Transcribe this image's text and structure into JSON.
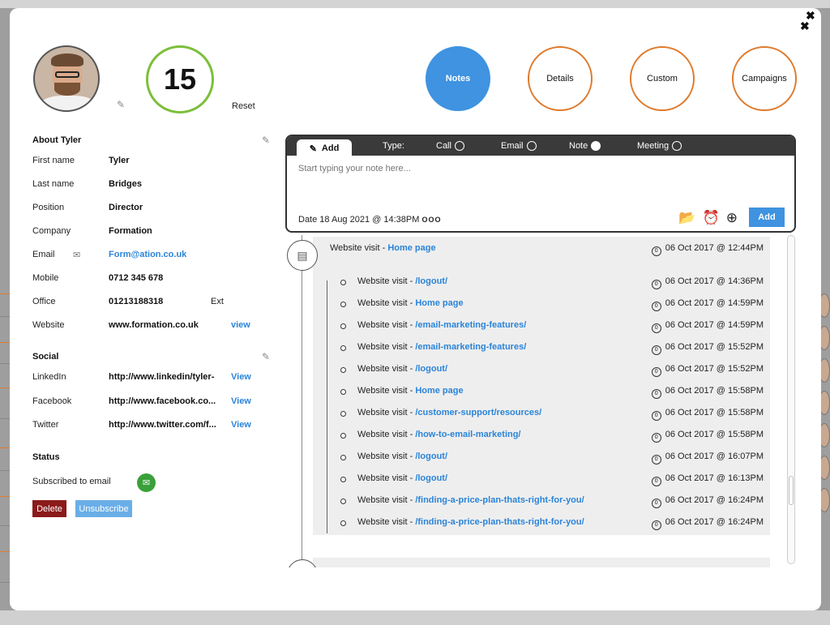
{
  "close_label": "✖",
  "contact": {
    "score": "15",
    "reset_label": "Reset"
  },
  "tabs": [
    {
      "label": "Notes",
      "active": true
    },
    {
      "label": "Details",
      "active": false
    },
    {
      "label": "Custom",
      "active": false
    },
    {
      "label": "Campaigns",
      "active": false
    }
  ],
  "about": {
    "title": "About Tyler",
    "fields": [
      {
        "label": "First name",
        "value": "Tyler"
      },
      {
        "label": "Last name",
        "value": "Bridges"
      },
      {
        "label": "Position",
        "value": "Director"
      },
      {
        "label": "Company",
        "value": "Formation"
      },
      {
        "label": "Email",
        "value": "Form@ation.co.uk"
      },
      {
        "label": "Mobile",
        "value": "0712 345 678"
      },
      {
        "label": "Office",
        "value": "01213188318",
        "ext_label": "Ext"
      },
      {
        "label": "Website",
        "value": "www.formation.co.uk",
        "action": "view"
      }
    ]
  },
  "social": {
    "title": "Social",
    "fields": [
      {
        "label": "LinkedIn",
        "value": "http://www.linkedin/tyler-",
        "action": "View"
      },
      {
        "label": "Facebook",
        "value": "http://www.facebook.co...",
        "action": "View"
      },
      {
        "label": "Twitter",
        "value": "http://www.twitter.com/f...",
        "action": "View"
      }
    ]
  },
  "status": {
    "title": "Status",
    "subscribed_label": "Subscribed to email",
    "delete_label": "Delete",
    "unsubscribe_label": "Unsubscribe"
  },
  "note": {
    "add_tab": "Add",
    "type_label": "Type:",
    "types": [
      {
        "label": "Call",
        "selected": false
      },
      {
        "label": "Email",
        "selected": false
      },
      {
        "label": "Note",
        "selected": true
      },
      {
        "label": "Meeting",
        "selected": false
      }
    ],
    "placeholder": "Start typing your note here...",
    "date_text": "Date 18 Aug 2021 @ 14:38PM",
    "more_label": "OOO",
    "add_button": "Add"
  },
  "timeline": {
    "main": {
      "prefix": "Website visit - ",
      "page": "Home page",
      "when": "06 Oct 2017 @ 12:44PM"
    },
    "items": [
      {
        "prefix": "Website visit - ",
        "page": "/logout/",
        "when": "06 Oct 2017 @ 14:36PM"
      },
      {
        "prefix": "Website visit - ",
        "page": "Home page",
        "when": "06 Oct 2017 @ 14:59PM"
      },
      {
        "prefix": "Website visit - ",
        "page": "/email-marketing-features/",
        "when": "06 Oct 2017 @ 14:59PM"
      },
      {
        "prefix": "Website visit - ",
        "page": "/email-marketing-features/",
        "when": "06 Oct 2017 @ 15:52PM"
      },
      {
        "prefix": "Website visit - ",
        "page": "/logout/",
        "when": "06 Oct 2017 @ 15:52PM"
      },
      {
        "prefix": "Website visit - ",
        "page": "Home page",
        "when": "06 Oct 2017 @ 15:58PM"
      },
      {
        "prefix": "Website visit - ",
        "page": "/customer-support/resources/",
        "when": "06 Oct 2017 @ 15:58PM"
      },
      {
        "prefix": "Website visit - ",
        "page": "/how-to-email-marketing/",
        "when": "06 Oct 2017 @ 15:58PM"
      },
      {
        "prefix": "Website visit - ",
        "page": "/logout/",
        "when": "06 Oct 2017 @ 16:07PM"
      },
      {
        "prefix": "Website visit - ",
        "page": "/logout/",
        "when": "06 Oct 2017 @ 16:13PM"
      },
      {
        "prefix": "Website visit - ",
        "page": "/finding-a-price-plan-thats-right-for-you/",
        "when": "06 Oct 2017 @ 16:24PM"
      },
      {
        "prefix": "Website visit - ",
        "page": "/finding-a-price-plan-thats-right-for-you/",
        "when": "06 Oct 2017 @ 16:24PM"
      }
    ]
  },
  "colors": {
    "accent": "#3f93e0",
    "tab_border": "#e07a2c",
    "score_ring": "#7cbf3a",
    "delete": "#8b1a1a",
    "link": "#2b84d8"
  }
}
